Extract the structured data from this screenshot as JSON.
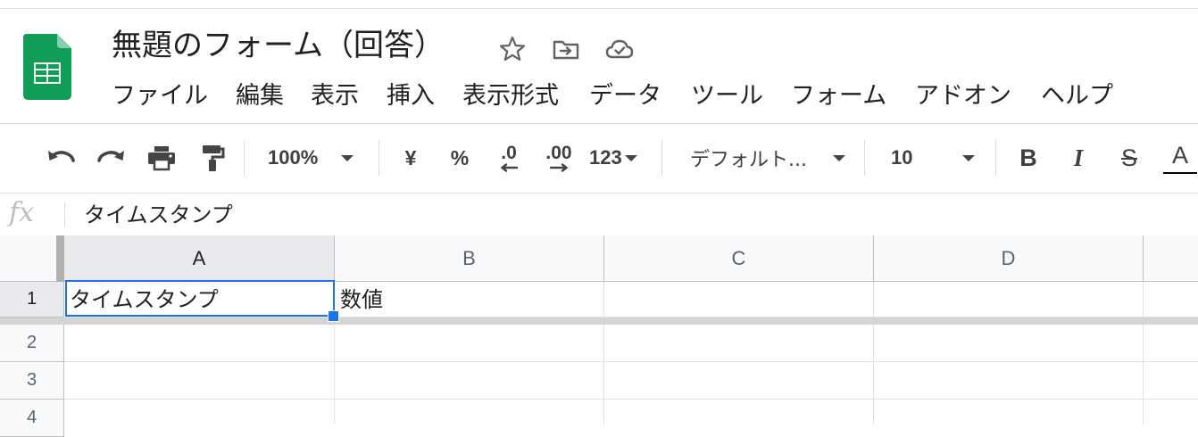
{
  "doc": {
    "title": "無題のフォーム（回答）",
    "star_icon": "star-icon",
    "move_icon": "move-to-folder-icon",
    "cloud_icon": "cloud-saved-icon"
  },
  "menu": [
    "ファイル",
    "編集",
    "表示",
    "挿入",
    "表示形式",
    "データ",
    "ツール",
    "フォーム",
    "アドオン",
    "ヘルプ"
  ],
  "toolbar": {
    "undo_icon": "undo-icon",
    "redo_icon": "redo-icon",
    "print_icon": "print-icon",
    "paint_format_icon": "paint-format-icon",
    "zoom": "100%",
    "currency": "¥",
    "percent": "%",
    "decrease_decimal": ".0",
    "increase_decimal": ".00",
    "more_formats": "123",
    "font": "デフォルト...",
    "font_size": "10",
    "bold": "B",
    "italic": "I",
    "strikethrough": "S",
    "text_color": "A"
  },
  "formula_bar": {
    "fx": "fx",
    "value": "タイムスタンプ"
  },
  "sheet": {
    "columns": [
      "A",
      "B",
      "C",
      "D"
    ],
    "rows": [
      "1",
      "2",
      "3",
      "4"
    ],
    "cells": {
      "A1": "タイムスタンプ",
      "B1": "数値"
    },
    "selected_cell": "A1"
  },
  "colors": {
    "accent": "#1a73e8",
    "sheets_green": "#0f9d58"
  }
}
